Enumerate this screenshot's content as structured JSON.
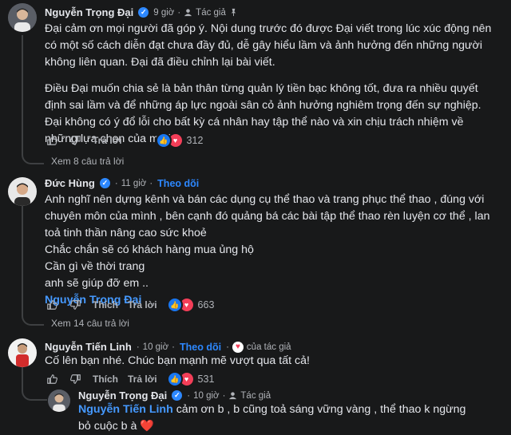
{
  "comments": [
    {
      "name": "Nguyễn Trọng Đại",
      "time": "9 giờ",
      "role": "Tác giả",
      "paragraphs": [
        "Đại cảm ơn mọi người đã góp ý. Nội dung trước đó được Đại viết trong lúc xúc động nên có một số cách diễn đạt chưa đầy đủ, dễ gây hiểu lầm và ảnh hưởng đến những người không liên quan. Đại đã điều chỉnh lại bài viết.",
        "Điều Đại muốn chia sẻ là bản thân từng quản lý tiền bạc không tốt, đưa ra nhiều quyết định sai lầm và để những áp lực ngoài sân cỏ ảnh hưởng nghiêm trọng đến sự nghiệp. Đại không có ý đổ lỗi cho bất kỳ cá nhân hay tập thể nào và xin chịu trách nhiệm về những lựa chọn của mình."
      ],
      "reply_label": "Trả lời",
      "reactions": "312",
      "view_replies": "Xem 8 câu trả lời"
    },
    {
      "name": "Đức Hùng",
      "time": "11 giờ",
      "follow": "Theo dõi",
      "lines": [
        "Anh nghĩ nên dựng kênh và bán các dụng cụ thể thao và trang phục thể thao , đúng với chuyên môn của mình , bên cạnh đó quảng bá các bài tập thể thao rèn luyện cơ thể , lan toả tinh thần nâng cao sức khoẻ",
        "Chắc chắn sẽ có khách hàng mua ủng hộ",
        "Cần gì về thời trang",
        "anh sẽ giúp đỡ em .."
      ],
      "tag": "Nguyễn Trọng Đại",
      "like_label": "Thích",
      "reply_label": "Trả lời",
      "reactions": "663",
      "view_replies": "Xem 14 câu trả lời"
    },
    {
      "name": "Nguyễn Tiến Linh",
      "time": "10 giờ",
      "follow": "Theo dõi",
      "author_reacted": "của tác giả",
      "text": "Cố lên bạn nhé. Chúc bạn mạnh mẽ vượt qua tất cả!",
      "like_label": "Thích",
      "reply_label": "Trả lời",
      "reactions": "531"
    },
    {
      "name": "Nguyễn Trọng Đại",
      "time": "10 giờ",
      "role": "Tác giả",
      "tag": "Nguyễn Tiến Linh",
      "text": " cảm ơn b , b cũng toả sáng vững vàng , thể thao k ngừng bỏ cuộc b à ❤️"
    }
  ],
  "colors": {
    "background": "#18191a",
    "accent": "#2d88ff",
    "text": "#e4e6eb",
    "muted": "#b0b3b8"
  }
}
